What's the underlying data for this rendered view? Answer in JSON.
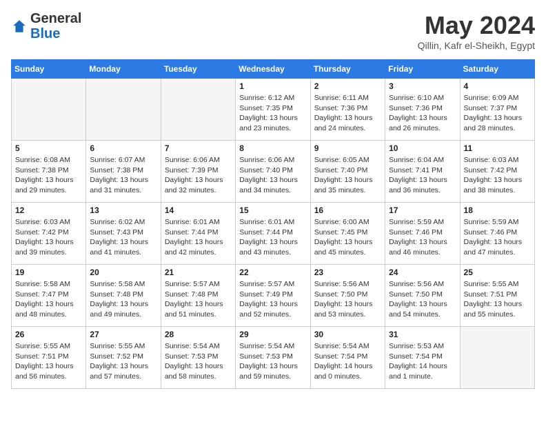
{
  "header": {
    "logo_general": "General",
    "logo_blue": "Blue",
    "month_title": "May 2024",
    "location": "Qillin, Kafr el-Sheikh, Egypt"
  },
  "weekdays": [
    "Sunday",
    "Monday",
    "Tuesday",
    "Wednesday",
    "Thursday",
    "Friday",
    "Saturday"
  ],
  "weeks": [
    [
      {
        "day": "",
        "content": ""
      },
      {
        "day": "",
        "content": ""
      },
      {
        "day": "",
        "content": ""
      },
      {
        "day": "1",
        "content": "Sunrise: 6:12 AM\nSunset: 7:35 PM\nDaylight: 13 hours\nand 23 minutes."
      },
      {
        "day": "2",
        "content": "Sunrise: 6:11 AM\nSunset: 7:36 PM\nDaylight: 13 hours\nand 24 minutes."
      },
      {
        "day": "3",
        "content": "Sunrise: 6:10 AM\nSunset: 7:36 PM\nDaylight: 13 hours\nand 26 minutes."
      },
      {
        "day": "4",
        "content": "Sunrise: 6:09 AM\nSunset: 7:37 PM\nDaylight: 13 hours\nand 28 minutes."
      }
    ],
    [
      {
        "day": "5",
        "content": "Sunrise: 6:08 AM\nSunset: 7:38 PM\nDaylight: 13 hours\nand 29 minutes."
      },
      {
        "day": "6",
        "content": "Sunrise: 6:07 AM\nSunset: 7:38 PM\nDaylight: 13 hours\nand 31 minutes."
      },
      {
        "day": "7",
        "content": "Sunrise: 6:06 AM\nSunset: 7:39 PM\nDaylight: 13 hours\nand 32 minutes."
      },
      {
        "day": "8",
        "content": "Sunrise: 6:06 AM\nSunset: 7:40 PM\nDaylight: 13 hours\nand 34 minutes."
      },
      {
        "day": "9",
        "content": "Sunrise: 6:05 AM\nSunset: 7:40 PM\nDaylight: 13 hours\nand 35 minutes."
      },
      {
        "day": "10",
        "content": "Sunrise: 6:04 AM\nSunset: 7:41 PM\nDaylight: 13 hours\nand 36 minutes."
      },
      {
        "day": "11",
        "content": "Sunrise: 6:03 AM\nSunset: 7:42 PM\nDaylight: 13 hours\nand 38 minutes."
      }
    ],
    [
      {
        "day": "12",
        "content": "Sunrise: 6:03 AM\nSunset: 7:42 PM\nDaylight: 13 hours\nand 39 minutes."
      },
      {
        "day": "13",
        "content": "Sunrise: 6:02 AM\nSunset: 7:43 PM\nDaylight: 13 hours\nand 41 minutes."
      },
      {
        "day": "14",
        "content": "Sunrise: 6:01 AM\nSunset: 7:44 PM\nDaylight: 13 hours\nand 42 minutes."
      },
      {
        "day": "15",
        "content": "Sunrise: 6:01 AM\nSunset: 7:44 PM\nDaylight: 13 hours\nand 43 minutes."
      },
      {
        "day": "16",
        "content": "Sunrise: 6:00 AM\nSunset: 7:45 PM\nDaylight: 13 hours\nand 45 minutes."
      },
      {
        "day": "17",
        "content": "Sunrise: 5:59 AM\nSunset: 7:46 PM\nDaylight: 13 hours\nand 46 minutes."
      },
      {
        "day": "18",
        "content": "Sunrise: 5:59 AM\nSunset: 7:46 PM\nDaylight: 13 hours\nand 47 minutes."
      }
    ],
    [
      {
        "day": "19",
        "content": "Sunrise: 5:58 AM\nSunset: 7:47 PM\nDaylight: 13 hours\nand 48 minutes."
      },
      {
        "day": "20",
        "content": "Sunrise: 5:58 AM\nSunset: 7:48 PM\nDaylight: 13 hours\nand 49 minutes."
      },
      {
        "day": "21",
        "content": "Sunrise: 5:57 AM\nSunset: 7:48 PM\nDaylight: 13 hours\nand 51 minutes."
      },
      {
        "day": "22",
        "content": "Sunrise: 5:57 AM\nSunset: 7:49 PM\nDaylight: 13 hours\nand 52 minutes."
      },
      {
        "day": "23",
        "content": "Sunrise: 5:56 AM\nSunset: 7:50 PM\nDaylight: 13 hours\nand 53 minutes."
      },
      {
        "day": "24",
        "content": "Sunrise: 5:56 AM\nSunset: 7:50 PM\nDaylight: 13 hours\nand 54 minutes."
      },
      {
        "day": "25",
        "content": "Sunrise: 5:55 AM\nSunset: 7:51 PM\nDaylight: 13 hours\nand 55 minutes."
      }
    ],
    [
      {
        "day": "26",
        "content": "Sunrise: 5:55 AM\nSunset: 7:51 PM\nDaylight: 13 hours\nand 56 minutes."
      },
      {
        "day": "27",
        "content": "Sunrise: 5:55 AM\nSunset: 7:52 PM\nDaylight: 13 hours\nand 57 minutes."
      },
      {
        "day": "28",
        "content": "Sunrise: 5:54 AM\nSunset: 7:53 PM\nDaylight: 13 hours\nand 58 minutes."
      },
      {
        "day": "29",
        "content": "Sunrise: 5:54 AM\nSunset: 7:53 PM\nDaylight: 13 hours\nand 59 minutes."
      },
      {
        "day": "30",
        "content": "Sunrise: 5:54 AM\nSunset: 7:54 PM\nDaylight: 14 hours\nand 0 minutes."
      },
      {
        "day": "31",
        "content": "Sunrise: 5:53 AM\nSunset: 7:54 PM\nDaylight: 14 hours\nand 1 minute."
      },
      {
        "day": "",
        "content": ""
      }
    ]
  ]
}
